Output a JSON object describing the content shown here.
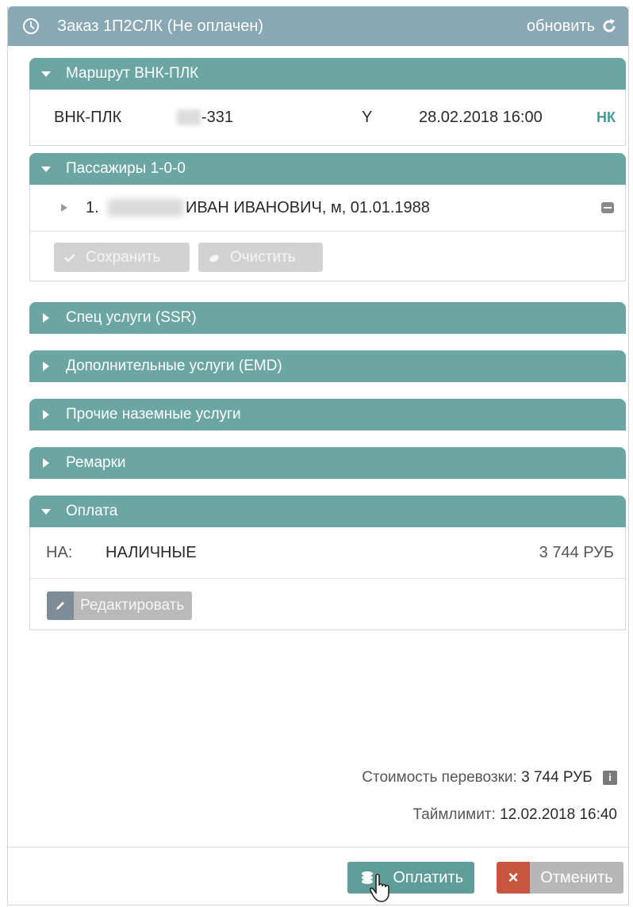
{
  "header": {
    "title": "Заказ 1П2СЛК (Не оплачен)",
    "refresh_label": "обновить"
  },
  "sections": {
    "route": {
      "title": "Маршрут ВНК-ПЛК",
      "segment": {
        "from_to": "ВНК-ПЛК",
        "flight": "-331",
        "class": "Y",
        "datetime": "28.02.2018 16:00",
        "status": "НК"
      }
    },
    "passengers": {
      "title": "Пассажиры 1-0-0",
      "list": [
        {
          "number": "1.",
          "details": "ИВАН ИВАНОВИЧ, м, 01.01.1988"
        }
      ],
      "save_label": "Сохранить",
      "clear_label": "Очистить"
    },
    "ssr": {
      "title": "Спец услуги (SSR)"
    },
    "emd": {
      "title": "Дополнительные услуги (EMD)"
    },
    "ground": {
      "title": "Прочие наземные услуги"
    },
    "remarks": {
      "title": "Ремарки"
    },
    "payment": {
      "title": "Оплата",
      "code": "НА:",
      "method": "НАЛИЧНЫЕ",
      "amount": "3 744 РУБ",
      "edit_label": "Редактировать"
    }
  },
  "totals": {
    "cost_label": "Стоимость перевозки:",
    "cost_value": "3 744 РУБ",
    "info_glyph": "i",
    "timelimit_label": "Таймлимит:",
    "timelimit_value": "12.02.2018 16:40"
  },
  "actions": {
    "pay_label": "Оплатить",
    "cancel_label": "Отменить"
  },
  "colors": {
    "title_bar": "#8aa7b4",
    "section_header": "#6ba6a3",
    "pay_button": "#5e9d98",
    "cancel_icon": "#c8553d"
  }
}
